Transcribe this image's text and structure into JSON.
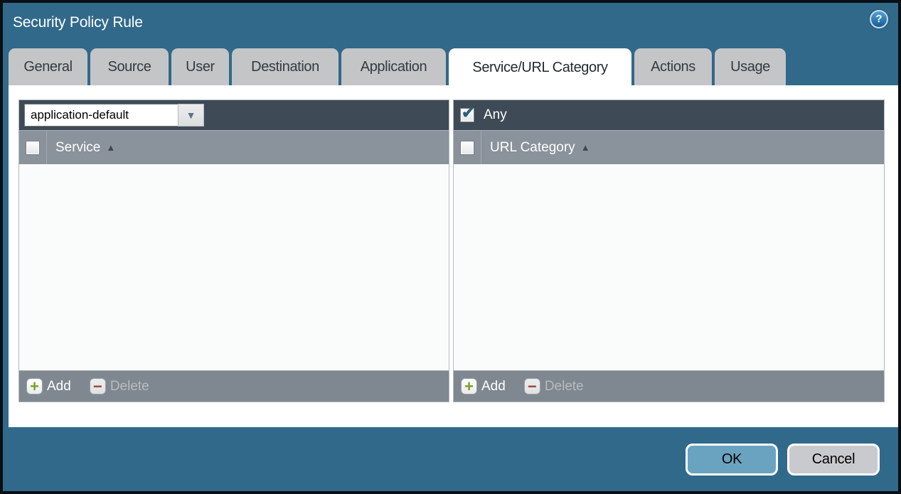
{
  "dialog": {
    "title": "Security Policy Rule"
  },
  "icons": {
    "help": "?",
    "dropdown_arrow": "▼",
    "sort_ascending": "▲",
    "checkmark": "✔",
    "add_plus": "+",
    "delete_minus": "−"
  },
  "tabs": [
    {
      "label": "General",
      "active": false
    },
    {
      "label": "Source",
      "active": false
    },
    {
      "label": "User",
      "active": false
    },
    {
      "label": "Destination",
      "active": false
    },
    {
      "label": "Application",
      "active": false
    },
    {
      "label": "Service/URL Category",
      "active": true
    },
    {
      "label": "Actions",
      "active": false
    },
    {
      "label": "Usage",
      "active": false
    }
  ],
  "service_panel": {
    "dropdown_value": "application-default",
    "select_all_checked": false,
    "column_header": "Service",
    "rows": [],
    "add_label": "Add",
    "delete_label": "Delete",
    "delete_enabled": false
  },
  "url_category_panel": {
    "any_label": "Any",
    "any_checked": true,
    "select_all_checked": false,
    "column_header": "URL Category",
    "rows": [],
    "add_label": "Add",
    "delete_label": "Delete",
    "delete_enabled": false
  },
  "footer": {
    "ok_label": "OK",
    "cancel_label": "Cancel"
  },
  "colors": {
    "dialog_background": "#31698a",
    "panel_header_dark": "#3e4a55",
    "column_header_gray": "#8a929b",
    "action_bar_gray": "#7f8890",
    "active_tab": "#ffffff",
    "inactive_tab": "#c4c5c7",
    "ok_button": "#69a3bf",
    "cancel_button": "#c9cacd",
    "add_icon_green": "#7aa024",
    "delete_icon_red": "#9c4633",
    "checkmark_blue": "#2d5d7c"
  }
}
